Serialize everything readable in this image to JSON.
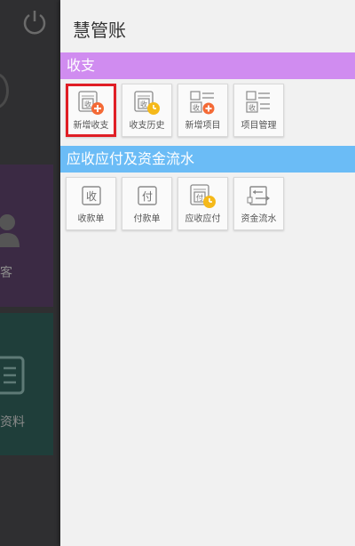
{
  "background": {
    "label_customers": "客",
    "label_materials": "资料"
  },
  "drawer": {
    "title": "慧管账",
    "sections": [
      {
        "label": "收支",
        "color": "#d08cf0",
        "items": [
          {
            "label": "新增收支",
            "icon": "income-add-icon",
            "highlighted": true
          },
          {
            "label": "收支历史",
            "icon": "income-history-icon"
          },
          {
            "label": "新增项目",
            "icon": "project-add-icon"
          },
          {
            "label": "项目管理",
            "icon": "project-manage-icon"
          }
        ]
      },
      {
        "label": "应收应付及资金流水",
        "color": "#6bbcf6",
        "items": [
          {
            "label": "收款单",
            "icon": "receipt-icon"
          },
          {
            "label": "付款单",
            "icon": "payment-icon"
          },
          {
            "label": "应收应付",
            "icon": "receivable-payable-icon"
          },
          {
            "label": "资金流水",
            "icon": "cash-flow-icon"
          }
        ]
      }
    ],
    "glyphs": {
      "receive": "收",
      "pay": "付"
    }
  },
  "colors": {
    "accent_orange": "#f46a36",
    "accent_yellow": "#f5b91a",
    "highlight_red": "#e01e25"
  }
}
